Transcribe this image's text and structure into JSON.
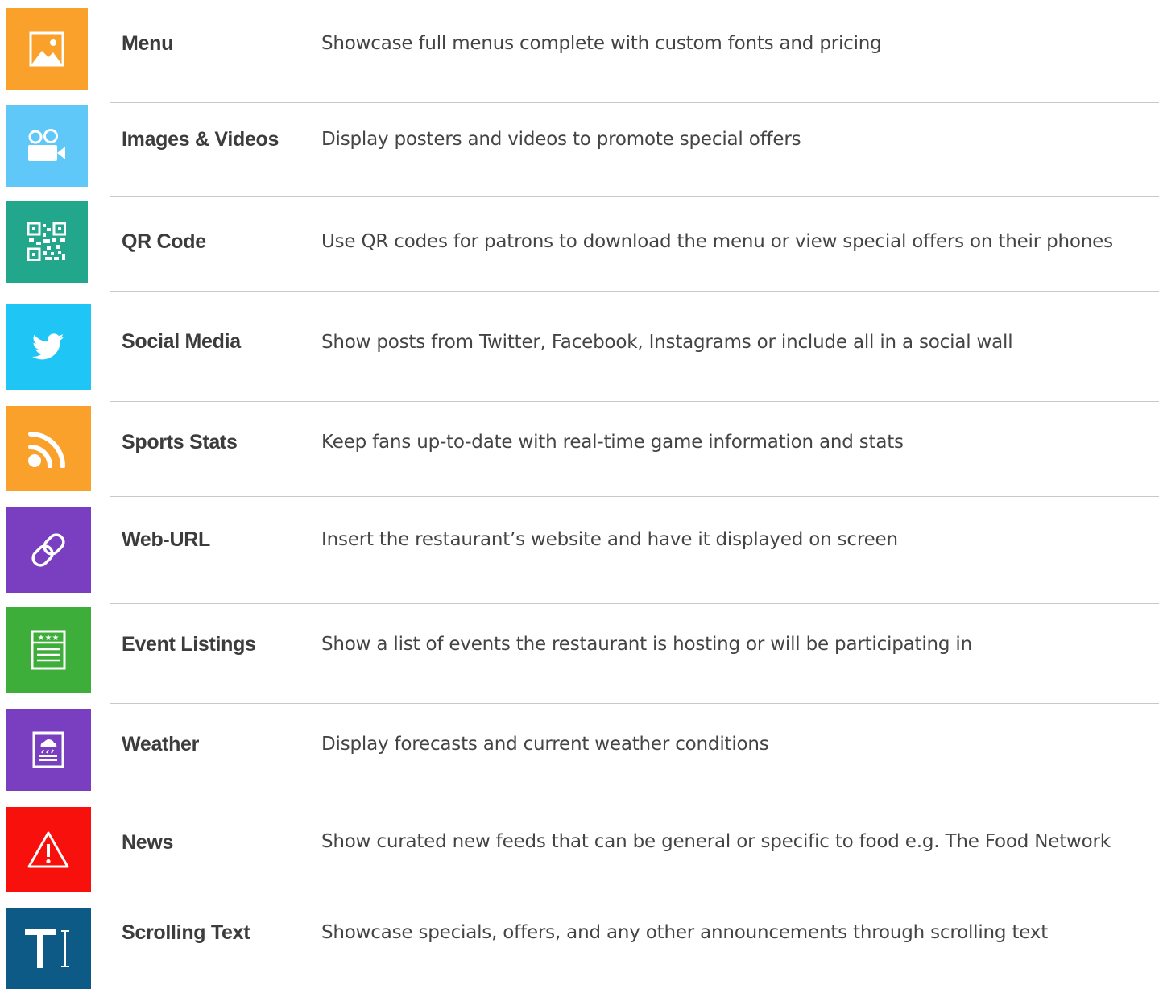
{
  "features": [
    {
      "title": "Menu",
      "description": "Showcase full menus complete with custom fonts and pricing",
      "icon": "image-icon",
      "color": "#f9a12a"
    },
    {
      "title": "Images & Videos",
      "description": "Display posters and videos to promote special offers",
      "icon": "video-camera-icon",
      "color": "#5fc8f8"
    },
    {
      "title": "QR Code",
      "description": "Use QR codes for patrons to download the menu or view special offers on their phones",
      "icon": "qr-code-icon",
      "color": "#22a68c"
    },
    {
      "title": "Social Media",
      "description": "Show posts from Twitter, Facebook, Instagrams or include all in a social wall",
      "icon": "twitter-bird-icon",
      "color": "#1ec5f5"
    },
    {
      "title": "Sports Stats",
      "description": "Keep fans up-to-date with real-time game information and stats",
      "icon": "rss-feed-icon",
      "color": "#f9a12a"
    },
    {
      "title": "Web-URL",
      "description": "Insert the restaurant’s website and have it displayed on screen",
      "icon": "link-icon",
      "color": "#7a3fc0"
    },
    {
      "title": "Event Listings",
      "description": "Show a list of events the restaurant is hosting or will be participating in",
      "icon": "event-list-icon",
      "color": "#3dae3a"
    },
    {
      "title": "Weather",
      "description": "Display forecasts and current weather conditions",
      "icon": "weather-cloud-icon",
      "color": "#7a3fc0"
    },
    {
      "title": "News",
      "description": "Show curated new feeds that can be general or specific to food e.g. The Food Network",
      "icon": "warning-triangle-icon",
      "color": "#f8110c"
    },
    {
      "title": "Scrolling Text",
      "description": "Showcase specials, offers, and any other announcements through scrolling text",
      "icon": "text-cursor-icon",
      "color": "#0e5a86"
    }
  ]
}
